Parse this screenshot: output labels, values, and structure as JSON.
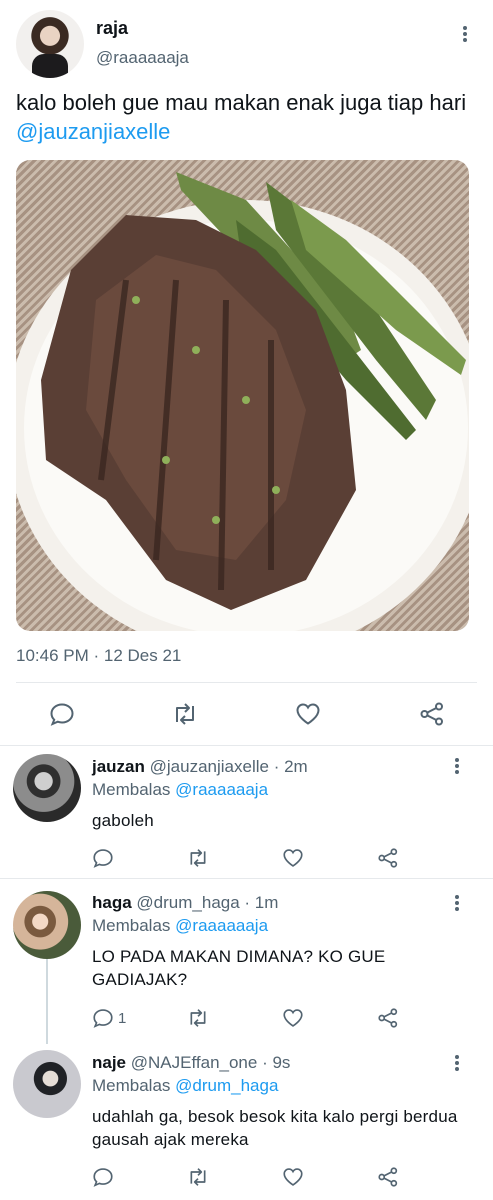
{
  "main_tweet": {
    "author_name": "raja",
    "author_handle": "@raaaaaaja",
    "text_before_mention": "kalo boleh gue mau makan enak juga tiap hari ",
    "mention": "@jauzanjiaxelle",
    "timestamp": "10:46 PM · 12 Des 21",
    "actions": [
      "reply-icon",
      "retweet-icon",
      "like-icon",
      "share-icon"
    ]
  },
  "replies": [
    {
      "name": "jauzan",
      "handle": "@jauzanjiaxelle",
      "time": "· 2m",
      "replying_label": "Membalas",
      "replying_to": "@raaaaaaja",
      "text": "gaboleh",
      "reply_count": ""
    },
    {
      "name": "haga",
      "handle": "@drum_haga",
      "time": "· 1m",
      "replying_label": "Membalas",
      "replying_to": "@raaaaaaja",
      "text": "LO PADA MAKAN DIMANA? KO GUE GADIAJAK?",
      "reply_count": "1"
    },
    {
      "name": "naje",
      "handle": "@NAJEffan_one",
      "time": "· 9s",
      "replying_label": "Membalas",
      "replying_to": "@drum_haga",
      "text": "udahlah ga, besok besok kita kalo pergi berdua gausah ajak mereka",
      "reply_count": ""
    }
  ],
  "colors": {
    "link": "#1d9bf0",
    "secondary_text": "#536471",
    "icon": "#536471",
    "divider": "#e6e9ec"
  }
}
